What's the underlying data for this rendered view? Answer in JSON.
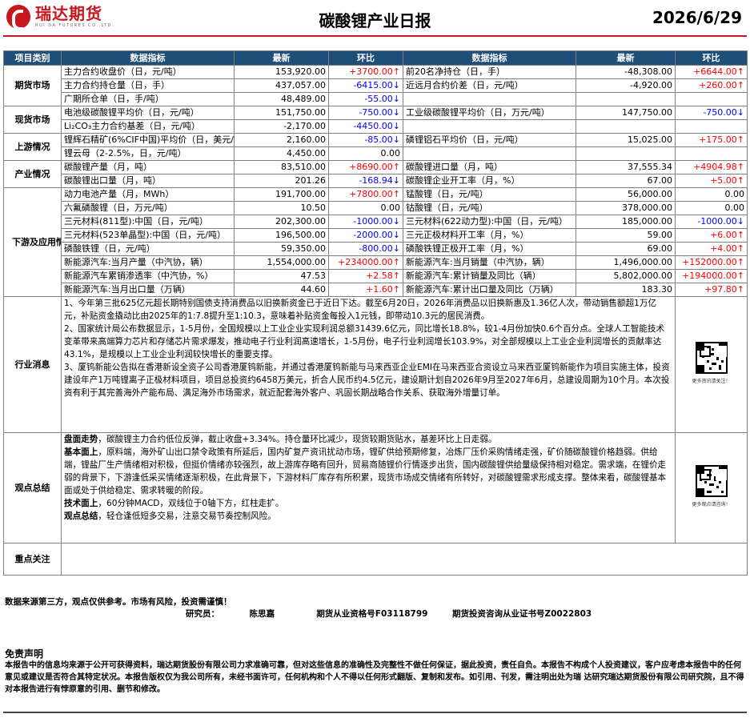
{
  "header": {
    "logo_cn": "瑞达期货",
    "logo_en": "RUI DA FUTURES CO.,LTD.",
    "title": "碳酸锂产业日报",
    "date": "2026/6/29"
  },
  "columns": [
    "项目类别",
    "数据指标",
    "最新",
    "环比",
    "数据指标",
    "最新",
    "环比"
  ],
  "sections": {
    "futures": "期货市场",
    "spot": "现货市场",
    "upstream": "上游情况",
    "industry": "产业情况",
    "downstream": "下游及应用情况",
    "news": "行业消息",
    "views": "观点总结",
    "focus": "重点关注"
  },
  "rows": [
    {
      "l_name": "主力合约收盘价（日，元/吨）",
      "l_val": "153,920.00",
      "l_chg": "+3700.00↑",
      "l_dir": "up",
      "r_name": "前20名净持仓（日，手）",
      "r_val": "-48,308.00",
      "r_chg": "+6644.00↑",
      "r_dir": "up"
    },
    {
      "l_name": "主力合约持仓量（日，手）",
      "l_val": "437,057.00",
      "l_chg": "-6415.00↓",
      "l_dir": "down",
      "r_name": "近远月合约价差（日，元/吨）",
      "r_val": "-4,920.00",
      "r_chg": "+260.00↑",
      "r_dir": "up"
    },
    {
      "l_name": "广期所仓单（日，手/吨）",
      "l_val": "48,489.00",
      "l_chg": "-55.00↓",
      "l_dir": "down",
      "r_name": "",
      "r_val": "",
      "r_chg": "",
      "r_dir": ""
    },
    {
      "l_name": "电池级碳酸锂平均价（日，元/吨）",
      "l_val": "151,750.00",
      "l_chg": "-750.00↓",
      "l_dir": "down",
      "r_name": "工业级碳酸锂平均价（日，万元/吨）",
      "r_val": "147,750.00",
      "r_chg": "-750.00↓",
      "r_dir": "down"
    },
    {
      "l_name": "Li₂CO₃主力合约基差（日，元/吨）",
      "l_val": "-2,170.00",
      "l_chg": "-4450.00↓",
      "l_dir": "down",
      "r_name": "",
      "r_val": "",
      "r_chg": "",
      "r_dir": ""
    },
    {
      "l_name": "锂辉石精矿(6%CIF中国)平均价（日，美元/吨）",
      "l_val": "2,160.00",
      "l_chg": "-85.00↓",
      "l_dir": "down",
      "r_name": "磷锂铝石平均价（日，元/吨）",
      "r_val": "15,025.00",
      "r_chg": "+175.00↑",
      "r_dir": "up"
    },
    {
      "l_name": "锂云母（2-2.5%，日，元/吨）",
      "l_val": "4,450.00",
      "l_chg": "0.00",
      "l_dir": "",
      "r_name": "",
      "r_val": "",
      "r_chg": "",
      "r_dir": ""
    },
    {
      "l_name": "碳酸锂产量（月，吨）",
      "l_val": "83,510.00",
      "l_chg": "+8690.00↑",
      "l_dir": "up",
      "r_name": "碳酸锂进口量（月，吨）",
      "r_val": "37,555.34",
      "r_chg": "+4904.98↑",
      "r_dir": "up"
    },
    {
      "l_name": "碳酸锂出口量（月，吨）",
      "l_val": "201.26",
      "l_chg": "-168.94↓",
      "l_dir": "down",
      "r_name": "碳酸锂企业开工率（月，%）",
      "r_val": "67.00",
      "r_chg": "+5.00↑",
      "r_dir": "up"
    },
    {
      "l_name": "动力电池产量（月，MWh）",
      "l_val": "191,700.00",
      "l_chg": "+7800.00↑",
      "l_dir": "up",
      "r_name": "锰酸锂（日，元/吨）",
      "r_val": "56,000.00",
      "r_chg": "0.00",
      "r_dir": ""
    },
    {
      "l_name": "六氟磷酸锂（日，万元/吨）",
      "l_val": "10.50",
      "l_chg": "0.00",
      "l_dir": "",
      "r_name": "钴酸锂（日，元/吨）",
      "r_val": "378,000.00",
      "r_chg": "0.00",
      "r_dir": ""
    },
    {
      "l_name": "三元材料(811型):中国（日，元/吨）",
      "l_val": "202,300.00",
      "l_chg": "-1000.00↓",
      "l_dir": "down",
      "r_name": "三元材料(622动力型):中国（日，元/吨）",
      "r_val": "185,000.00",
      "r_chg": "-1000.00↓",
      "r_dir": "down"
    },
    {
      "l_name": "三元材料(523单晶型):中国（日，元/吨）",
      "l_val": "196,500.00",
      "l_chg": "-2000.00↓",
      "l_dir": "down",
      "r_name": "三元正极材料开工率（月，%）",
      "r_val": "59.00",
      "r_chg": "+6.00↑",
      "r_dir": "up"
    },
    {
      "l_name": "磷酸铁锂（日，元/吨）",
      "l_val": "59,350.00",
      "l_chg": "-800.00↓",
      "l_dir": "down",
      "r_name": "磷酸铁锂正极开工率（月，%）",
      "r_val": "69.00",
      "r_chg": "+4.00↑",
      "r_dir": "up"
    },
    {
      "l_name": "新能源汽车:当月产量（中汽协，辆）",
      "l_val": "1,554,000.00",
      "l_chg": "+234000.00↑",
      "l_dir": "up",
      "r_name": "新能源汽车:当月销量（中汽协，辆）",
      "r_val": "1,496,000.00",
      "r_chg": "+152000.00↑",
      "r_dir": "up"
    },
    {
      "l_name": "新能源汽车累销渗透率（中汽协，%）",
      "l_val": "47.53",
      "l_chg": "+2.58↑",
      "l_dir": "up",
      "r_name": "新能源汽车:累计销量及同比（辆）",
      "r_val": "5,802,000.00",
      "r_chg": "+194000.00↑",
      "r_dir": "up"
    },
    {
      "l_name": "新能源汽车:当月出口量（万辆）",
      "l_val": "44.60",
      "l_chg": "+1.60↑",
      "l_dir": "up",
      "r_name": "新能源汽车:累计出口量及同比（万辆）",
      "r_val": "183.30",
      "r_chg": "+97.80↑",
      "r_dir": "up"
    }
  ],
  "news": [
    "1、今年第三批625亿元超长期特别国债支持消费品以旧换新资金已于近日下达。截至6月20日，2026年消费品以旧换新惠及1.36亿人次，带动销售额超1万亿元，补贴资金撬动比由2025年的1:7.8提升至1:10.3，意味着补贴资金每投入1元钱，即带动10.3元的居民消费。",
    "2、国家统计局公布数据显示，1-5月份，全国规模以上工业企业实现利润总额31439.6亿元，同比增长18.8%，较1-4月份加快0.6个百分点。全球人工智能技术变革带来高端算力芯片和存储芯片需求爆发，推动电子行业利润高速增长，1-5月份，电子行业利润增长103.9%，对全部规模以上工业企业利润增长的贡献率达43.1%，是规模以上工业企业利润较快增长的重要支撑。",
    "3、厦钨新能公告拟在香港新设全资子公司香港厦钨新能，并通过香港厦钨新能与马来西亚企业EMI在马来西亚合资设立马来西亚厦钨新能作为项目实施主体，投资建设年产1万吨锂离子正极材料项目，项目总投资约6458万美元，折合人民币约4.5亿元，建设期计划自2026年9月至2027年6月，总建设周期为10个月。本次投资有利于其完善海外产能布局、满足海外市场需求，就近配套海外客户、巩固长期战略合作关系、获取海外增量订单。"
  ],
  "views": {
    "p1_label": "盘面走势",
    "p1_text": "，碳酸锂主力合约低位反弹，截止收盘+3.34%。持仓量环比减少，现货较期货贴水，基差环比上日走弱。",
    "p2_label": "基本面上",
    "p2_text": "，原料端，海外矿山出口禁令政策有所延后，国内矿复产资讯扰动市场，锂矿供给预期修复，冶炼厂压价采购情绪走强，矿价随碳酸锂价格趋弱。供给端，锂盐厂生产情绪相对积极，但挺价情绪亦较强烈，故上游库存略有回升，贸易商随锂价行情逐步出货，国内碳酸锂供给量级保持相对稳定。需求端，在锂价走弱的背景下，下游逢低采买情绪逐渐积极，在此背景下，下游材料厂库存有所积累，现货市场成交情绪有所转好，对碳酸锂需求形成支撑。整体来看，碳酸锂基本面或处于供给稳定、需求转暖的阶段。",
    "p3_label": "技术面上",
    "p3_text": "，60分钟MACD，双线位于0轴下方，红柱走扩。",
    "p4_label": "观点总结",
    "p4_text": "，轻仓逢低短多交易，注意交易节奏控制风险。"
  },
  "qr_caption_1": "更多资讯请关注！",
  "qr_caption_2": "更多观点请咨询！",
  "footer": {
    "source": "数据来源第三方，观点仅供参考。市场有风险，投资需谨慎！",
    "researcher_label": "研究员：",
    "researcher": "陈思嘉",
    "license1": "期货从业资格号F03118799",
    "license2": "期货投资咨询从业证书号Z0022803",
    "disclaimer_title": "免责声明",
    "disclaimer": "本报告中的信息均来源于公开可获得资料，瑞达期货股份有限公司力求准确可靠，但对这些信息的准确性及完整性不做任何保证，据此投资，责任自负。本报告不构成个人投资建议，客户应考虑本报告中的任何意见或建议是否符合其特定状况。本报告版权仅为我公司所有，未经书面许可，任何机构和个人不得以任何形式翻版、复制和发布。如引用、刊发，需注明出处为瑞 达研究瑞达期货股份有限公司研究院，且不得对本报告进行有悖原意的引用、删节和修改。"
  }
}
